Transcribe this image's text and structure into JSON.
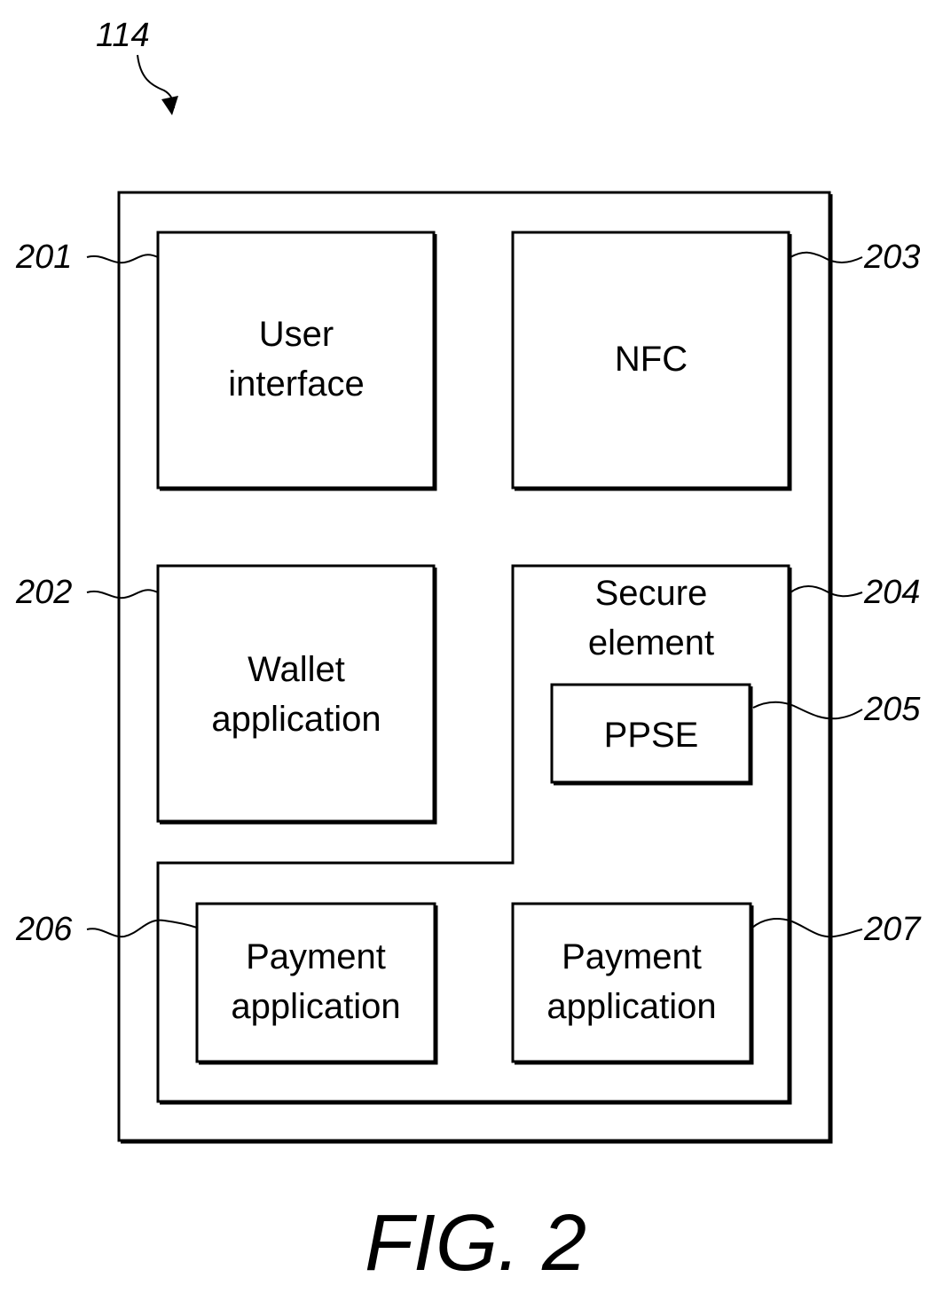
{
  "figure": {
    "ref_number": "114",
    "caption": "FIG. 2"
  },
  "blocks": {
    "user_interface": {
      "ref": "201",
      "line1": "User",
      "line2": "interface"
    },
    "wallet": {
      "ref": "202",
      "line1": "Wallet",
      "line2": "application"
    },
    "nfc": {
      "ref": "203",
      "line1": "NFC"
    },
    "secure_element": {
      "ref": "204",
      "line1": "Secure",
      "line2": "element"
    },
    "ppse": {
      "ref": "205",
      "line1": "PPSE"
    },
    "payment_left": {
      "ref": "206",
      "line1": "Payment",
      "line2": "application"
    },
    "payment_right": {
      "ref": "207",
      "line1": "Payment",
      "line2": "application"
    }
  }
}
